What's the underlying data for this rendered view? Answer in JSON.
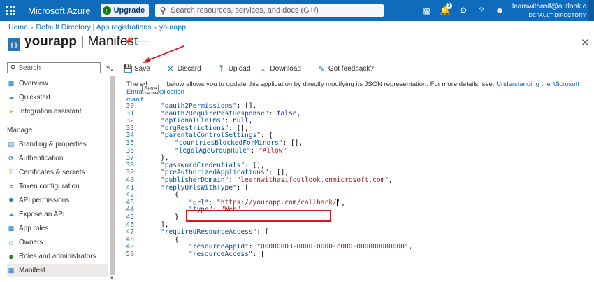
{
  "topbar": {
    "brand": "Microsoft Azure",
    "upgrade_label": "Upgrade",
    "search_placeholder": "Search resources, services, and docs (G+/)",
    "notification_count": "3",
    "user_email": "learnwithasif@outlook.c...",
    "user_directory": "DEFAULT DIRECTORY"
  },
  "breadcrumb": [
    "Home",
    "Default Directory | App registrations",
    "yourapp"
  ],
  "page": {
    "app_name": "yourapp",
    "section": "Manifest"
  },
  "sidebar": {
    "search_placeholder": "Search",
    "items_top": [
      {
        "label": "Overview",
        "icon": "overview-icon"
      },
      {
        "label": "Quickstart",
        "icon": "quickstart-icon"
      },
      {
        "label": "Integration assistant",
        "icon": "rocket-icon"
      }
    ],
    "manage_heading": "Manage",
    "items_manage": [
      {
        "label": "Branding & properties",
        "icon": "branding-icon"
      },
      {
        "label": "Authentication",
        "icon": "authentication-icon"
      },
      {
        "label": "Certificates & secrets",
        "icon": "key-icon"
      },
      {
        "label": "Token configuration",
        "icon": "token-icon"
      },
      {
        "label": "API permissions",
        "icon": "api-permissions-icon"
      },
      {
        "label": "Expose an API",
        "icon": "cloud-icon"
      },
      {
        "label": "App roles",
        "icon": "app-roles-icon"
      },
      {
        "label": "Owners",
        "icon": "owners-icon"
      },
      {
        "label": "Roles and administrators",
        "icon": "roles-icon"
      },
      {
        "label": "Manifest",
        "icon": "manifest-icon",
        "active": true
      }
    ]
  },
  "toolbar": {
    "save": "Save",
    "discard": "Discard",
    "upload": "Upload",
    "download": "Download",
    "feedback": "Got feedback?",
    "tooltip": "Save"
  },
  "description": {
    "text_before": "The ed",
    "text_after": "below allows you to update this application by directly modifying its JSON representation. For more details, see:",
    "link_line1": "Understanding the Microsoft Entra ID application",
    "link_line2": "manif"
  },
  "editor": {
    "lines": [
      {
        "n": "30",
        "indent": 0,
        "key": "oauth2Permissions",
        "rest": ": [],"
      },
      {
        "n": "31",
        "indent": 0,
        "key": "oauth2RequirePostResponse",
        "rest": ": ",
        "lit": "false",
        "tail": ","
      },
      {
        "n": "32",
        "indent": 0,
        "key": "optionalClaims",
        "rest": ": ",
        "lit": "null",
        "tail": ","
      },
      {
        "n": "33",
        "indent": 0,
        "key": "orgRestrictions",
        "rest": ": [],"
      },
      {
        "n": "34",
        "indent": 0,
        "key": "parentalControlSettings",
        "rest": ": {"
      },
      {
        "n": "35",
        "indent": 1,
        "key": "countriesBlockedForMinors",
        "rest": ": [],"
      },
      {
        "n": "36",
        "indent": 1,
        "key": "legalAgeGroupRule",
        "rest": ": ",
        "str": "\"Allow\""
      },
      {
        "n": "37",
        "indent": 0,
        "plain": "},"
      },
      {
        "n": "38",
        "indent": 0,
        "key": "passwordCredentials",
        "rest": ": [],"
      },
      {
        "n": "39",
        "indent": 0,
        "key": "preAuthorizedApplications",
        "rest": ": [],"
      },
      {
        "n": "40",
        "indent": 0,
        "key": "publisherDomain",
        "rest": ": ",
        "str": "\"learnwithasifoutlook.onmicrosoft.com\"",
        "tail": ","
      },
      {
        "n": "41",
        "indent": 0,
        "key": "replyUrlsWithType",
        "rest": ": ["
      },
      {
        "n": "42",
        "indent": 1,
        "plain": "{"
      },
      {
        "n": "43",
        "indent": 2,
        "key": "url",
        "rest": ": ",
        "str": "\"https://yourapp.com/callback/\"",
        "tail": ",",
        "cursor": true
      },
      {
        "n": "44",
        "indent": 2,
        "key": "type",
        "rest": ": ",
        "str": "\"Web\""
      },
      {
        "n": "45",
        "indent": 1,
        "plain": "}"
      },
      {
        "n": "46",
        "indent": 0,
        "plain": "],"
      },
      {
        "n": "47",
        "indent": 0,
        "key": "requiredResourceAccess",
        "rest": ": ["
      },
      {
        "n": "48",
        "indent": 1,
        "plain": "{"
      },
      {
        "n": "49",
        "indent": 2,
        "key": "resourceAppId",
        "rest": ": ",
        "str": "\"00000003-0000-0000-c000-000000000000\"",
        "tail": ","
      },
      {
        "n": "50",
        "indent": 2,
        "key": "resourceAccess",
        "rest": ": ["
      }
    ]
  },
  "colors": {
    "topbar": "#0f6cbd",
    "link": "#0f6cbd",
    "annotation_red": "#d9141e",
    "json_key": "#0451a5",
    "json_string": "#a31515",
    "json_literal": "#0000ff"
  }
}
